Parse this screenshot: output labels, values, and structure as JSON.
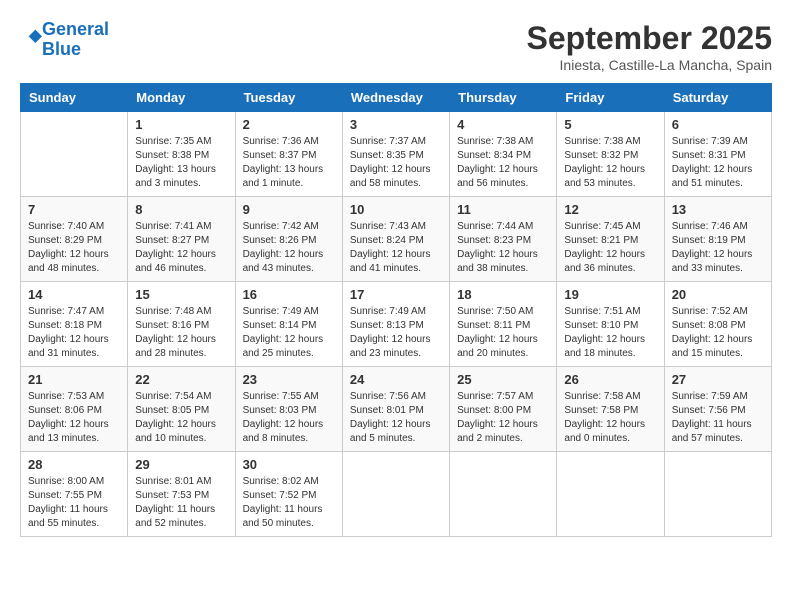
{
  "header": {
    "logo_line1": "General",
    "logo_line2": "Blue",
    "month": "September 2025",
    "location": "Iniesta, Castille-La Mancha, Spain"
  },
  "columns": [
    "Sunday",
    "Monday",
    "Tuesday",
    "Wednesday",
    "Thursday",
    "Friday",
    "Saturday"
  ],
  "weeks": [
    [
      {
        "day": "",
        "text": ""
      },
      {
        "day": "1",
        "text": "Sunrise: 7:35 AM\nSunset: 8:38 PM\nDaylight: 13 hours\nand 3 minutes."
      },
      {
        "day": "2",
        "text": "Sunrise: 7:36 AM\nSunset: 8:37 PM\nDaylight: 13 hours\nand 1 minute."
      },
      {
        "day": "3",
        "text": "Sunrise: 7:37 AM\nSunset: 8:35 PM\nDaylight: 12 hours\nand 58 minutes."
      },
      {
        "day": "4",
        "text": "Sunrise: 7:38 AM\nSunset: 8:34 PM\nDaylight: 12 hours\nand 56 minutes."
      },
      {
        "day": "5",
        "text": "Sunrise: 7:38 AM\nSunset: 8:32 PM\nDaylight: 12 hours\nand 53 minutes."
      },
      {
        "day": "6",
        "text": "Sunrise: 7:39 AM\nSunset: 8:31 PM\nDaylight: 12 hours\nand 51 minutes."
      }
    ],
    [
      {
        "day": "7",
        "text": "Sunrise: 7:40 AM\nSunset: 8:29 PM\nDaylight: 12 hours\nand 48 minutes."
      },
      {
        "day": "8",
        "text": "Sunrise: 7:41 AM\nSunset: 8:27 PM\nDaylight: 12 hours\nand 46 minutes."
      },
      {
        "day": "9",
        "text": "Sunrise: 7:42 AM\nSunset: 8:26 PM\nDaylight: 12 hours\nand 43 minutes."
      },
      {
        "day": "10",
        "text": "Sunrise: 7:43 AM\nSunset: 8:24 PM\nDaylight: 12 hours\nand 41 minutes."
      },
      {
        "day": "11",
        "text": "Sunrise: 7:44 AM\nSunset: 8:23 PM\nDaylight: 12 hours\nand 38 minutes."
      },
      {
        "day": "12",
        "text": "Sunrise: 7:45 AM\nSunset: 8:21 PM\nDaylight: 12 hours\nand 36 minutes."
      },
      {
        "day": "13",
        "text": "Sunrise: 7:46 AM\nSunset: 8:19 PM\nDaylight: 12 hours\nand 33 minutes."
      }
    ],
    [
      {
        "day": "14",
        "text": "Sunrise: 7:47 AM\nSunset: 8:18 PM\nDaylight: 12 hours\nand 31 minutes."
      },
      {
        "day": "15",
        "text": "Sunrise: 7:48 AM\nSunset: 8:16 PM\nDaylight: 12 hours\nand 28 minutes."
      },
      {
        "day": "16",
        "text": "Sunrise: 7:49 AM\nSunset: 8:14 PM\nDaylight: 12 hours\nand 25 minutes."
      },
      {
        "day": "17",
        "text": "Sunrise: 7:49 AM\nSunset: 8:13 PM\nDaylight: 12 hours\nand 23 minutes."
      },
      {
        "day": "18",
        "text": "Sunrise: 7:50 AM\nSunset: 8:11 PM\nDaylight: 12 hours\nand 20 minutes."
      },
      {
        "day": "19",
        "text": "Sunrise: 7:51 AM\nSunset: 8:10 PM\nDaylight: 12 hours\nand 18 minutes."
      },
      {
        "day": "20",
        "text": "Sunrise: 7:52 AM\nSunset: 8:08 PM\nDaylight: 12 hours\nand 15 minutes."
      }
    ],
    [
      {
        "day": "21",
        "text": "Sunrise: 7:53 AM\nSunset: 8:06 PM\nDaylight: 12 hours\nand 13 minutes."
      },
      {
        "day": "22",
        "text": "Sunrise: 7:54 AM\nSunset: 8:05 PM\nDaylight: 12 hours\nand 10 minutes."
      },
      {
        "day": "23",
        "text": "Sunrise: 7:55 AM\nSunset: 8:03 PM\nDaylight: 12 hours\nand 8 minutes."
      },
      {
        "day": "24",
        "text": "Sunrise: 7:56 AM\nSunset: 8:01 PM\nDaylight: 12 hours\nand 5 minutes."
      },
      {
        "day": "25",
        "text": "Sunrise: 7:57 AM\nSunset: 8:00 PM\nDaylight: 12 hours\nand 2 minutes."
      },
      {
        "day": "26",
        "text": "Sunrise: 7:58 AM\nSunset: 7:58 PM\nDaylight: 12 hours\nand 0 minutes."
      },
      {
        "day": "27",
        "text": "Sunrise: 7:59 AM\nSunset: 7:56 PM\nDaylight: 11 hours\nand 57 minutes."
      }
    ],
    [
      {
        "day": "28",
        "text": "Sunrise: 8:00 AM\nSunset: 7:55 PM\nDaylight: 11 hours\nand 55 minutes."
      },
      {
        "day": "29",
        "text": "Sunrise: 8:01 AM\nSunset: 7:53 PM\nDaylight: 11 hours\nand 52 minutes."
      },
      {
        "day": "30",
        "text": "Sunrise: 8:02 AM\nSunset: 7:52 PM\nDaylight: 11 hours\nand 50 minutes."
      },
      {
        "day": "",
        "text": ""
      },
      {
        "day": "",
        "text": ""
      },
      {
        "day": "",
        "text": ""
      },
      {
        "day": "",
        "text": ""
      }
    ]
  ]
}
